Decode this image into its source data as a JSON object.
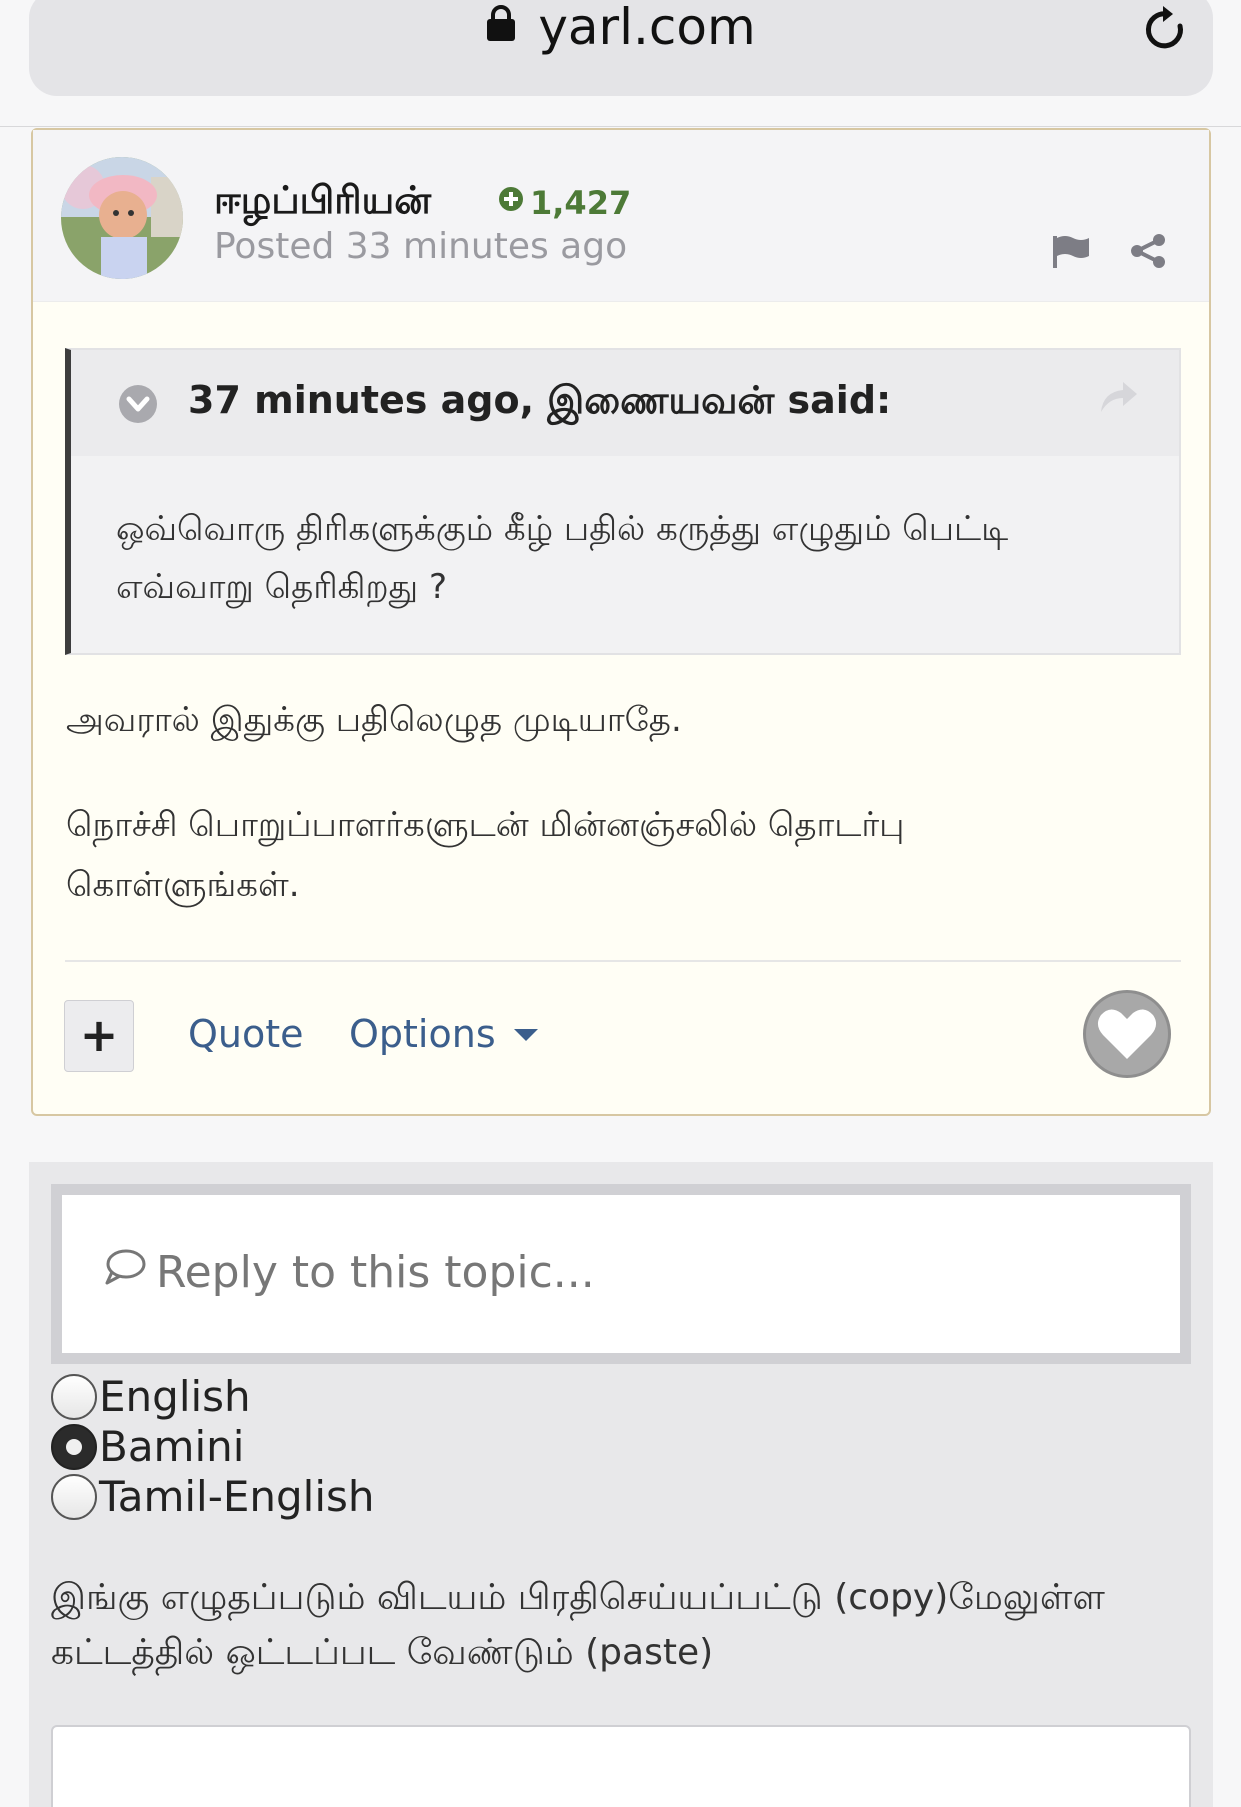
{
  "browser": {
    "url": "yarl.com"
  },
  "post": {
    "author": "ஈழப்பிரியன்",
    "reputation": "1,427",
    "posted": "Posted 33 minutes ago",
    "quote": {
      "cite": "37 minutes ago, இணையவன் said:",
      "text": "ஒவ்வொரு திரிகளுக்கும் கீழ் பதில் கருத்து எழுதும் பெட்டி எவ்வாறு தெரிகிறது ?"
    },
    "paragraphs": [
      "அவரால் இதுக்கு பதிலெழுத முடியாதே.",
      "நொச்சி பொறுப்பாளர்களுடன் மின்னஞ்சலில் தொடர்பு கொள்ளுங்கள்."
    ],
    "actions": {
      "plus": "+",
      "quote": "Quote",
      "options": "Options"
    }
  },
  "reply": {
    "placeholder": "Reply to this topic...",
    "input_modes": [
      {
        "label": "English",
        "checked": false
      },
      {
        "label": "Bamini",
        "checked": true
      },
      {
        "label": "Tamil-English",
        "checked": false
      }
    ],
    "note": "இங்கு எழுதப்படும் விடயம் பிரதிசெய்யப்பட்டு (copy)மேலுள்ள கட்டத்தில் ஒட்டப்பட வேண்டும் (paste)"
  },
  "colors": {
    "accent_link": "#3b5e8c",
    "reputation_green": "#4d7a37",
    "post_border": "#d7c7a2"
  },
  "icons": [
    "lock-icon",
    "reload-icon",
    "reputation-plus-icon",
    "flag-icon",
    "share-icon",
    "quote-toggle-icon",
    "quote-forward-icon",
    "heart-icon",
    "speech-bubble-icon"
  ]
}
